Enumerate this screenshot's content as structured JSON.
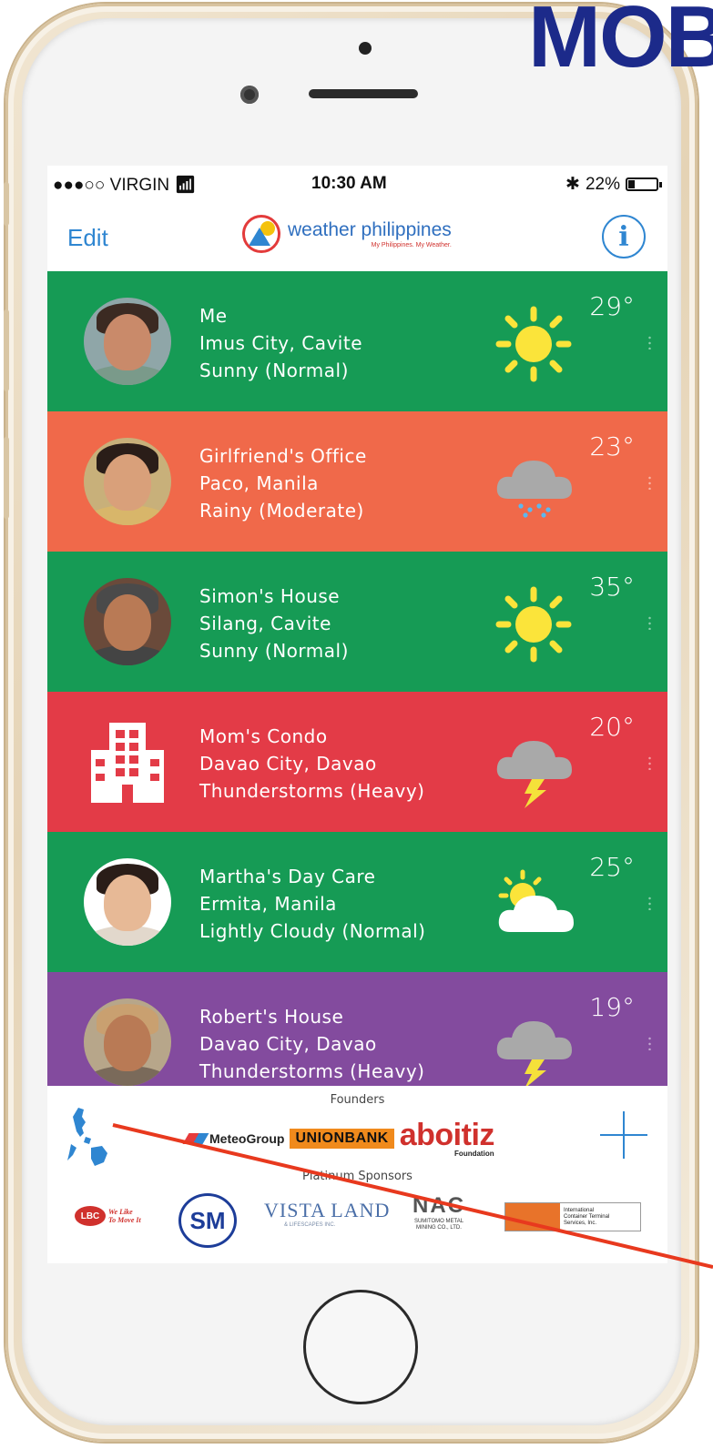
{
  "overlay": {
    "heading": "MOB"
  },
  "status_bar": {
    "carrier": "●●●○○ VIRGIN",
    "time": "10:30 AM",
    "battery": "22%",
    "battery_level": 0.22
  },
  "nav": {
    "edit_label": "Edit",
    "brand_name": "weather philippines",
    "brand_tagline": "My Philippines. My Weather.",
    "info_glyph": "i"
  },
  "locations": [
    {
      "label": "Me",
      "place": "Imus City, Cavite",
      "condition": "Sunny (Normal)",
      "temp": "29°",
      "weather": "sun-icon",
      "avatar": "person",
      "color": "#169b55"
    },
    {
      "label": "Girlfriend's Office",
      "place": "Paco, Manila",
      "condition": "Rainy (Moderate)",
      "temp": "23°",
      "weather": "rain-cloud-icon",
      "avatar": "person",
      "color": "#f0694a"
    },
    {
      "label": "Simon's House",
      "place": "Silang, Cavite",
      "condition": "Sunny (Normal)",
      "temp": "35°",
      "weather": "sun-icon",
      "avatar": "person",
      "color": "#169b55"
    },
    {
      "label": "Mom's Condo",
      "place": "Davao City, Davao",
      "condition": "Thunderstorms (Heavy)",
      "temp": "20°",
      "weather": "storm-cloud-icon",
      "avatar": "building-icon",
      "color": "#e33b47"
    },
    {
      "label": "Martha's Day Care",
      "place": "Ermita, Manila",
      "condition": "Lightly Cloudy (Normal)",
      "temp": "25°",
      "weather": "partly-cloudy-icon",
      "avatar": "person",
      "color": "#169b55"
    },
    {
      "label": "Robert's House",
      "place": "Davao City, Davao",
      "condition": "Thunderstorms (Heavy)",
      "temp": "19°",
      "weather": "storm-cloud-icon",
      "avatar": "person",
      "color": "#834b9e"
    }
  ],
  "footer": {
    "founders_label": "Founders",
    "platinum_label": "Platinum Sponsors",
    "founders": {
      "meteo": "MeteoGroup",
      "unionbank": "UNIONBANK",
      "aboitiz": "aboitiz",
      "aboitiz_sub": "Foundation"
    },
    "sponsors": {
      "lbc": "LBC",
      "lbc_slogan_1": "We Like",
      "lbc_slogan_2": "To Move It",
      "sm": "SM",
      "vista": "VISTA LAND",
      "vista_sub": "& LIFESCAPES INC.",
      "nac": "NAC",
      "nac_sub_1": "SUMITOMO METAL",
      "nac_sub_2": "MINING CO., LTD.",
      "ictsi_1": "International",
      "ictsi_2": "Container Terminal",
      "ictsi_3": "Services, Inc."
    }
  },
  "colors": {
    "accent_blue": "#2f86d1",
    "green": "#169b55",
    "orange": "#f0694a",
    "red": "#e33b47",
    "purple": "#834b9e",
    "annotation_line": "#e8391e"
  }
}
